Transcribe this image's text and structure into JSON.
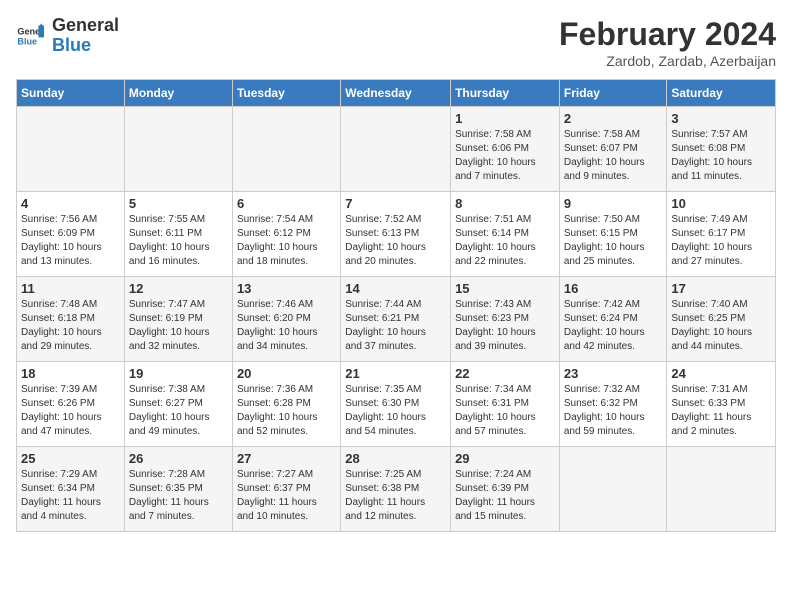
{
  "header": {
    "logo_general": "General",
    "logo_blue": "Blue",
    "title": "February 2024",
    "subtitle": "Zardob, Zardab, Azerbaijan"
  },
  "weekdays": [
    "Sunday",
    "Monday",
    "Tuesday",
    "Wednesday",
    "Thursday",
    "Friday",
    "Saturday"
  ],
  "rows": [
    {
      "cells": [
        {
          "day": "",
          "info": ""
        },
        {
          "day": "",
          "info": ""
        },
        {
          "day": "",
          "info": ""
        },
        {
          "day": "",
          "info": ""
        },
        {
          "day": "1",
          "info": "Sunrise: 7:58 AM\nSunset: 6:06 PM\nDaylight: 10 hours\nand 7 minutes."
        },
        {
          "day": "2",
          "info": "Sunrise: 7:58 AM\nSunset: 6:07 PM\nDaylight: 10 hours\nand 9 minutes."
        },
        {
          "day": "3",
          "info": "Sunrise: 7:57 AM\nSunset: 6:08 PM\nDaylight: 10 hours\nand 11 minutes."
        }
      ]
    },
    {
      "cells": [
        {
          "day": "4",
          "info": "Sunrise: 7:56 AM\nSunset: 6:09 PM\nDaylight: 10 hours\nand 13 minutes."
        },
        {
          "day": "5",
          "info": "Sunrise: 7:55 AM\nSunset: 6:11 PM\nDaylight: 10 hours\nand 16 minutes."
        },
        {
          "day": "6",
          "info": "Sunrise: 7:54 AM\nSunset: 6:12 PM\nDaylight: 10 hours\nand 18 minutes."
        },
        {
          "day": "7",
          "info": "Sunrise: 7:52 AM\nSunset: 6:13 PM\nDaylight: 10 hours\nand 20 minutes."
        },
        {
          "day": "8",
          "info": "Sunrise: 7:51 AM\nSunset: 6:14 PM\nDaylight: 10 hours\nand 22 minutes."
        },
        {
          "day": "9",
          "info": "Sunrise: 7:50 AM\nSunset: 6:15 PM\nDaylight: 10 hours\nand 25 minutes."
        },
        {
          "day": "10",
          "info": "Sunrise: 7:49 AM\nSunset: 6:17 PM\nDaylight: 10 hours\nand 27 minutes."
        }
      ]
    },
    {
      "cells": [
        {
          "day": "11",
          "info": "Sunrise: 7:48 AM\nSunset: 6:18 PM\nDaylight: 10 hours\nand 29 minutes."
        },
        {
          "day": "12",
          "info": "Sunrise: 7:47 AM\nSunset: 6:19 PM\nDaylight: 10 hours\nand 32 minutes."
        },
        {
          "day": "13",
          "info": "Sunrise: 7:46 AM\nSunset: 6:20 PM\nDaylight: 10 hours\nand 34 minutes."
        },
        {
          "day": "14",
          "info": "Sunrise: 7:44 AM\nSunset: 6:21 PM\nDaylight: 10 hours\nand 37 minutes."
        },
        {
          "day": "15",
          "info": "Sunrise: 7:43 AM\nSunset: 6:23 PM\nDaylight: 10 hours\nand 39 minutes."
        },
        {
          "day": "16",
          "info": "Sunrise: 7:42 AM\nSunset: 6:24 PM\nDaylight: 10 hours\nand 42 minutes."
        },
        {
          "day": "17",
          "info": "Sunrise: 7:40 AM\nSunset: 6:25 PM\nDaylight: 10 hours\nand 44 minutes."
        }
      ]
    },
    {
      "cells": [
        {
          "day": "18",
          "info": "Sunrise: 7:39 AM\nSunset: 6:26 PM\nDaylight: 10 hours\nand 47 minutes."
        },
        {
          "day": "19",
          "info": "Sunrise: 7:38 AM\nSunset: 6:27 PM\nDaylight: 10 hours\nand 49 minutes."
        },
        {
          "day": "20",
          "info": "Sunrise: 7:36 AM\nSunset: 6:28 PM\nDaylight: 10 hours\nand 52 minutes."
        },
        {
          "day": "21",
          "info": "Sunrise: 7:35 AM\nSunset: 6:30 PM\nDaylight: 10 hours\nand 54 minutes."
        },
        {
          "day": "22",
          "info": "Sunrise: 7:34 AM\nSunset: 6:31 PM\nDaylight: 10 hours\nand 57 minutes."
        },
        {
          "day": "23",
          "info": "Sunrise: 7:32 AM\nSunset: 6:32 PM\nDaylight: 10 hours\nand 59 minutes."
        },
        {
          "day": "24",
          "info": "Sunrise: 7:31 AM\nSunset: 6:33 PM\nDaylight: 11 hours\nand 2 minutes."
        }
      ]
    },
    {
      "cells": [
        {
          "day": "25",
          "info": "Sunrise: 7:29 AM\nSunset: 6:34 PM\nDaylight: 11 hours\nand 4 minutes."
        },
        {
          "day": "26",
          "info": "Sunrise: 7:28 AM\nSunset: 6:35 PM\nDaylight: 11 hours\nand 7 minutes."
        },
        {
          "day": "27",
          "info": "Sunrise: 7:27 AM\nSunset: 6:37 PM\nDaylight: 11 hours\nand 10 minutes."
        },
        {
          "day": "28",
          "info": "Sunrise: 7:25 AM\nSunset: 6:38 PM\nDaylight: 11 hours\nand 12 minutes."
        },
        {
          "day": "29",
          "info": "Sunrise: 7:24 AM\nSunset: 6:39 PM\nDaylight: 11 hours\nand 15 minutes."
        },
        {
          "day": "",
          "info": ""
        },
        {
          "day": "",
          "info": ""
        }
      ]
    }
  ]
}
